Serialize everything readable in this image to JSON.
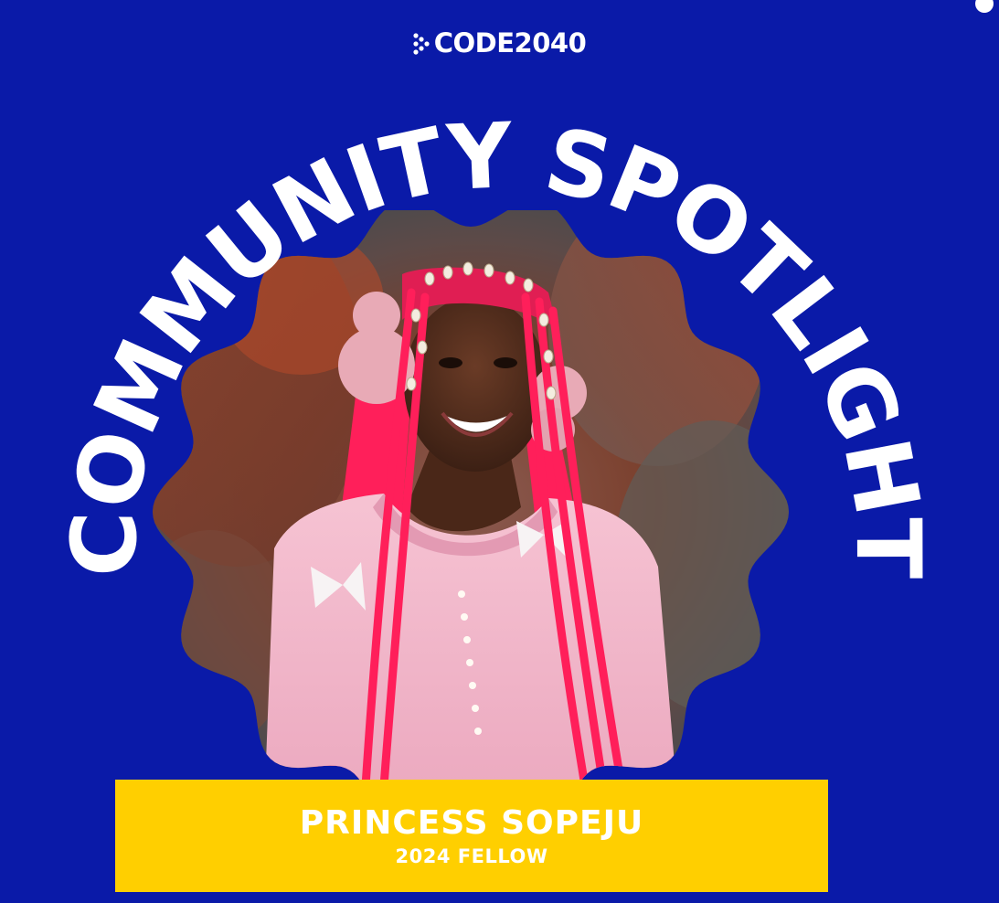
{
  "brand": {
    "logo_text": "CODE2040"
  },
  "headline": {
    "text": "COMMUNITY SPOTLIGHT"
  },
  "feature": {
    "name": "PRINCESS SOPEJU",
    "role": "2024 FELLOW"
  },
  "colors": {
    "background": "#0a1aa8",
    "banner": "#ffcf00",
    "text": "#ffffff",
    "hair_accent": "#ff1f5a",
    "top_accent": "#f4b9cc"
  },
  "icons": {
    "logo_mark": "chevron-dots-icon"
  }
}
